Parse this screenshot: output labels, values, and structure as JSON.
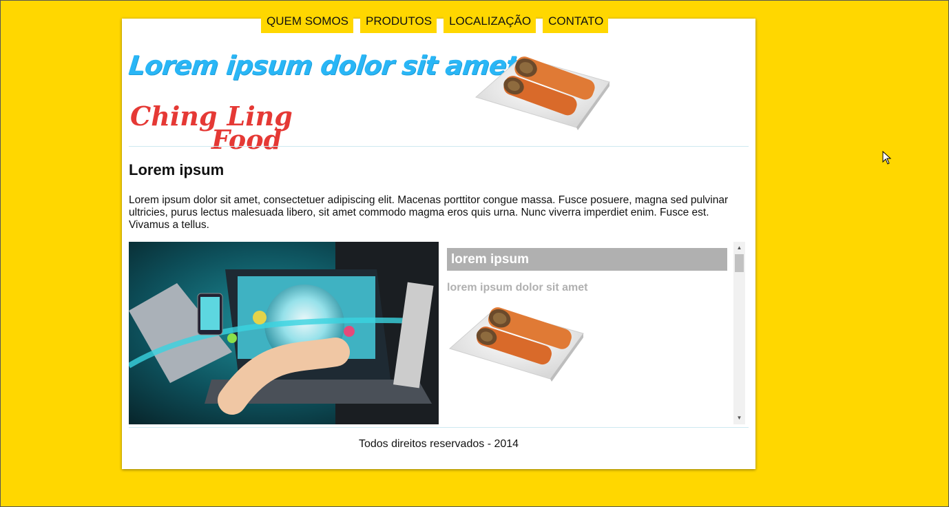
{
  "nav": {
    "items": [
      {
        "label": "QUEM SOMOS"
      },
      {
        "label": "PRODUTOS"
      },
      {
        "label": "LOCALIZAÇÃO"
      },
      {
        "label": "CONTATO"
      }
    ]
  },
  "header": {
    "slogan": "Lorem ipsum dolor sit amet",
    "brand_word1": "Ching",
    "brand_word2": "Ling",
    "brand_word3": "Food"
  },
  "main": {
    "title": "Lorem ipsum",
    "paragraph": "Lorem ipsum dolor sit amet, consectetuer adipiscing elit. Macenas porttitor congue massa. Fusce posuere, magna sed pulvinar ultricies, purus lectus malesuada libero, sit amet commodo magma eros quis urna. Nunc viverra imperdiet enim. Fusce est. Vivamus a tellus."
  },
  "sidebar_box": {
    "header": "lorem ipsum",
    "subtitle": "lorem ipsum dolor sit amet"
  },
  "footer": {
    "text": "Todos direitos reservados - 2014"
  },
  "colors": {
    "background": "#FFD700",
    "slogan": "#29B6F6",
    "brand": "#E53935",
    "box_header": "#B0B0B0"
  }
}
